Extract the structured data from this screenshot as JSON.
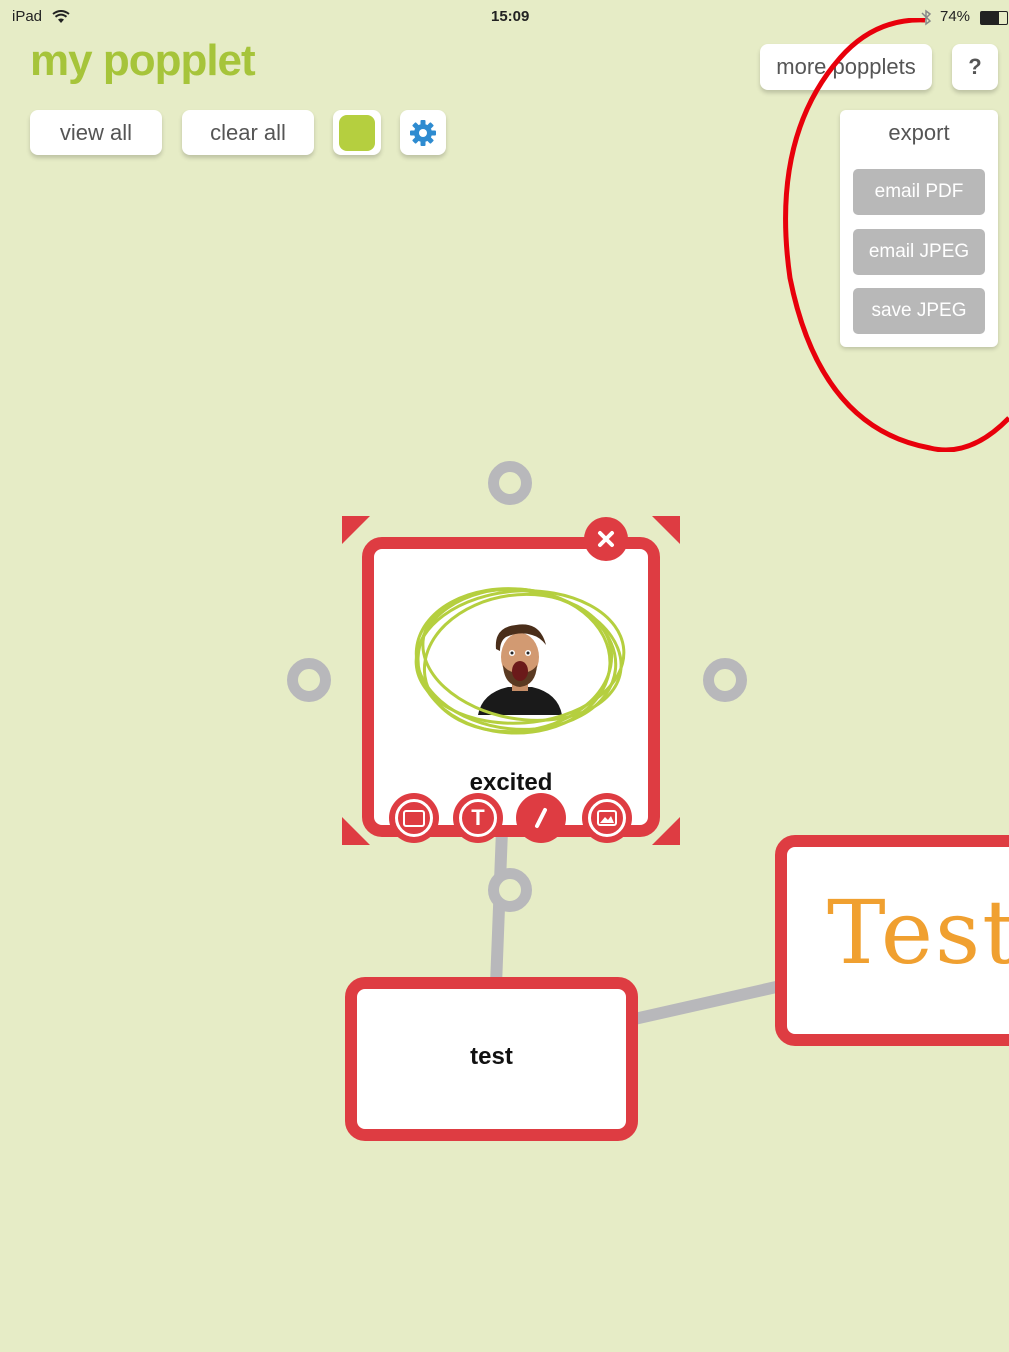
{
  "status_bar": {
    "device": "iPad",
    "time": "15:09",
    "battery": "74%"
  },
  "app": {
    "title": "my popplet"
  },
  "toolbar": {
    "view_all": "view all",
    "clear_all": "clear all",
    "more_popplets": "more popplets",
    "help": "?"
  },
  "export_menu": {
    "title": "export",
    "items": [
      {
        "label": "email PDF"
      },
      {
        "label": "email JPEG"
      },
      {
        "label": "save JPEG"
      }
    ]
  },
  "popples": {
    "excited": {
      "label": "excited"
    },
    "test": {
      "label": "test"
    },
    "handwritten": {
      "text": "Test"
    }
  },
  "colors": {
    "background": "#e6ecc6",
    "accent_green": "#a6c43a",
    "popple_red": "#de3c42",
    "settings_blue": "#2e8bd0",
    "connector_gray": "#b8b8bb",
    "highlight_circle": "#e8000b",
    "drawing_green": "#b5cf3f",
    "handwriting_orange": "#f0a030"
  },
  "icons": [
    "wifi-icon",
    "bluetooth-icon",
    "battery-icon",
    "color-swatch-icon",
    "gear-icon",
    "close-icon",
    "frame-icon",
    "text-icon",
    "pen-icon",
    "image-icon"
  ]
}
